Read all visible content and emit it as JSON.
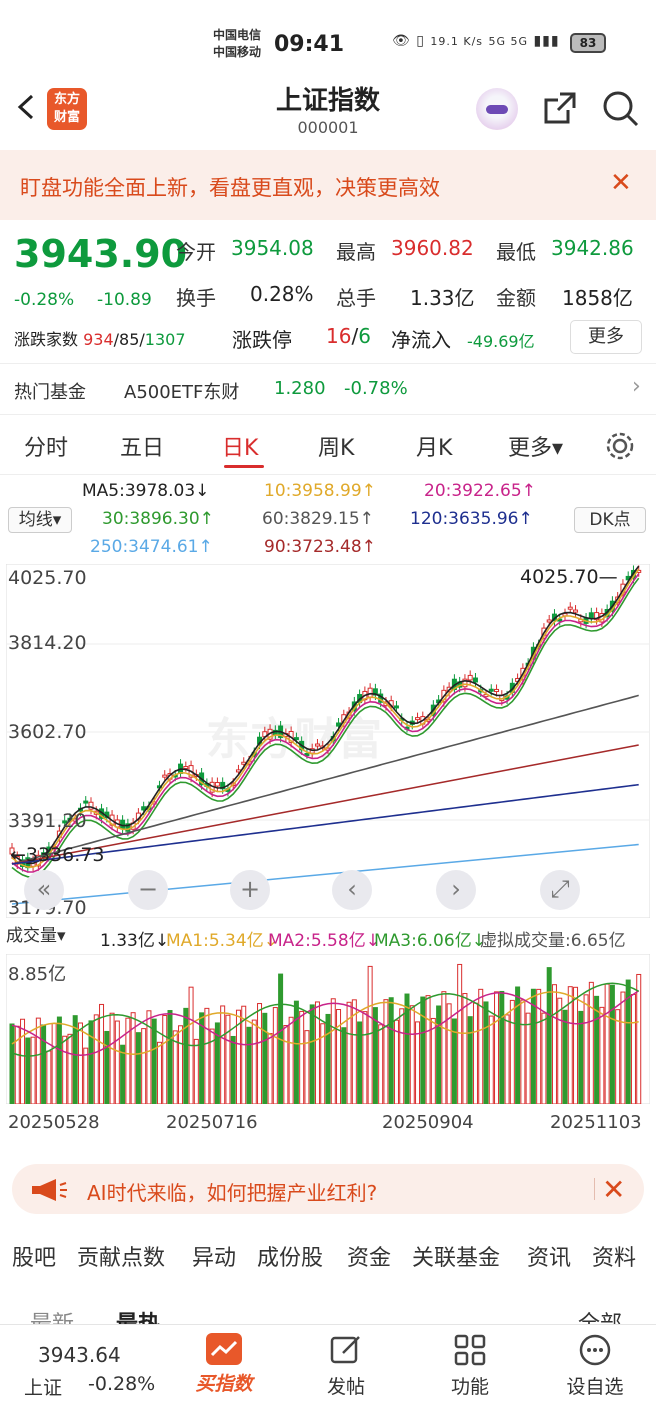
{
  "status_bar": {
    "carrier1": "中国电信",
    "carrier2": "中国移动",
    "time": "09:41",
    "speed": "19.1 K/s",
    "signal": "5G 5G",
    "battery": "83"
  },
  "header": {
    "logo": "东方财富",
    "title": "上证指数",
    "code": "000001"
  },
  "banner": {
    "text": "盯盘功能全面上新，看盘更直观，决策更高效",
    "close": "✕"
  },
  "quote": {
    "price": "3943.90",
    "change_pct": "-0.28%",
    "change": "-10.89",
    "open_label": "今开",
    "open": "3954.08",
    "high_label": "最高",
    "high": "3960.82",
    "low_label": "最低",
    "low": "3942.86",
    "turnover_label": "换手",
    "turnover": "0.28%",
    "volume_label": "总手",
    "volume": "1.33亿",
    "amount_label": "金额",
    "amount": "1858亿",
    "breadth_label": "涨跌家数",
    "up": "934",
    "flat": "85",
    "down": "1307",
    "limit_label": "涨跌停",
    "limit_up": "16",
    "limit_down": "6",
    "inflow_label": "净流入",
    "inflow": "-49.69亿",
    "more": "更多"
  },
  "fund": {
    "label": "热门基金",
    "name": "A500ETF东财",
    "price": "1.280",
    "change": "-0.78%",
    "arrow": "›"
  },
  "tabs": [
    "分时",
    "五日",
    "日K",
    "周K",
    "月K",
    "更多▾"
  ],
  "active_tab": "日K",
  "ma": {
    "selector": "均线▾",
    "dk": "DK点",
    "ma5": "MA5:3978.03↓",
    "ma10": "10:3958.99↑",
    "ma20": "20:3922.65↑",
    "ma30": "30:3896.30↑",
    "ma60": "60:3829.15↑",
    "ma120": "120:3635.96↑",
    "ma250": "250:3474.61↑",
    "ma90": "90:3723.48↑"
  },
  "chart_axis": {
    "y1": "4025.70",
    "y2": "3814.20",
    "y3": "3602.70",
    "y4": "3391.20",
    "y5": "3179.70",
    "max_label": "4025.70—",
    "min_label": "←3336.73",
    "watermark": "东方财富"
  },
  "volume": {
    "selector": "成交量▾",
    "vol": "1.33亿↓",
    "ma1": "MA1:5.34亿↓",
    "ma2": "MA2:5.58亿↓",
    "ma3": "MA3:6.06亿↓",
    "virtual": "虚拟成交量:6.65亿",
    "top": "8.85亿"
  },
  "dates": [
    "20250528",
    "20250716",
    "20250904",
    "20251103"
  ],
  "ad": {
    "text": "AI时代来临，如何把握产业红利?",
    "close": "✕"
  },
  "bottom_tabs": [
    "股吧",
    "贡献点数",
    "异动",
    "成份股",
    "资金",
    "关联基金",
    "资讯",
    "资料"
  ],
  "sub_tabs": {
    "latest": "最新",
    "hot": "最热",
    "all": "全部"
  },
  "tabbar": {
    "price": "3943.64",
    "name": "上证",
    "pct": "-0.28%",
    "buy": "买指数",
    "post": "发帖",
    "func": "功能",
    "watch": "设自选"
  },
  "colors": {
    "up": "#d92d2d",
    "down": "#0e9a3d",
    "accent": "#e8582a"
  }
}
